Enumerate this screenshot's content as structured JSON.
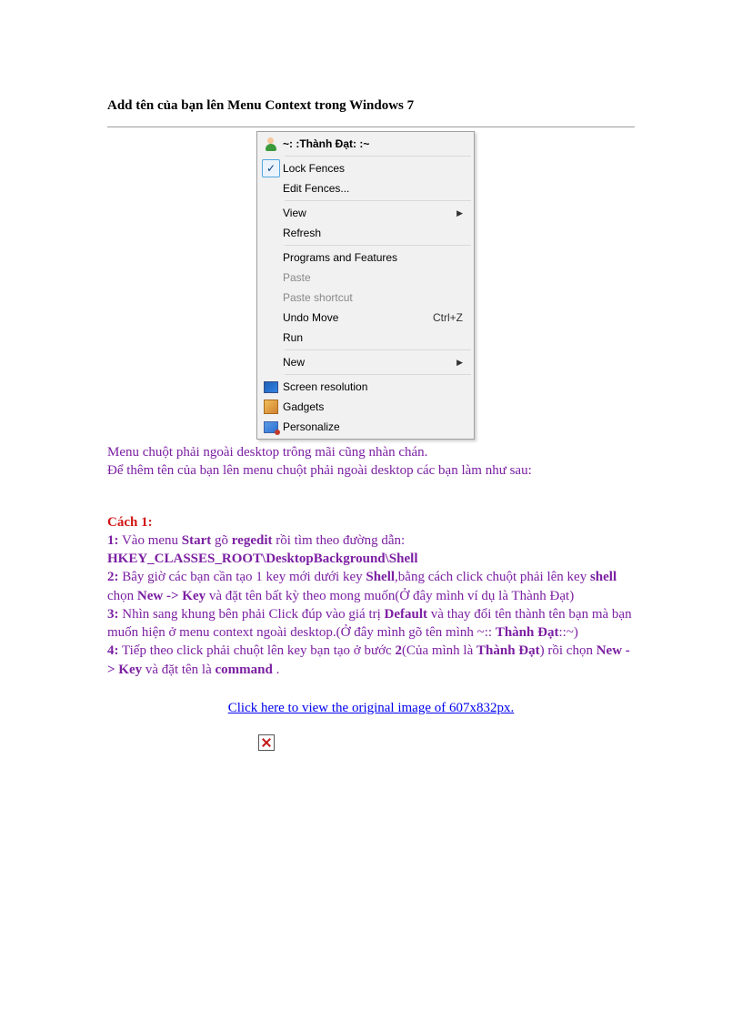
{
  "title": "Add tên của bạn lên Menu Context trong Windows  7",
  "menu": {
    "user_label": "~: :Thành Đạt: :~",
    "lock_fences": "Lock Fences",
    "edit_fences": "Edit Fences...",
    "view": "View",
    "refresh": "Refresh",
    "programs": "Programs and Features",
    "paste": "Paste",
    "paste_shortcut": "Paste shortcut",
    "undo_move": "Undo Move",
    "undo_short": "Ctrl+Z",
    "run": "Run",
    "new": "New",
    "screen_res": "Screen resolution",
    "gadgets": "Gadgets",
    "personalize": "Personalize"
  },
  "text": {
    "p1": "Menu chuột phải ngoài  desktop trông mãi cũng nhàn chán.",
    "p2": "Để thêm tên của bạn lên menu  chuột phải ngoài desktop các bạn làm như sau:",
    "cach1": "Cách 1:",
    "s1a": "1:",
    "s1b": " Vào menu  ",
    "s1c": "Start",
    "s1d": " gõ ",
    "s1e": "regedit",
    "s1f": " rồi tìm theo đường dẫn:",
    "s1path": "HKEY_CLASSES_ROOT\\DesktopBackground\\Shell",
    "s2a": "2:",
    "s2b": " Bây giờ các bạn cần tạo 1 key mới  dưới key ",
    "s2c": "Shell",
    "s2d": ",bằng cách click  chuột phải lên key ",
    "s2e": "shell",
    "s2f": " chọn ",
    "s2g": "New -> Key",
    "s2h": " và đặt tên bất kỳ theo mong muốn(Ở đây mình  ví dụ là Thành Đạt)",
    "s3a": "3:",
    "s3b": " Nhìn sang khung bên phải Click đúp vào giá trị ",
    "s3c": "Default",
    "s3d": " và thay đổi tên thành tên bạn mà bạn muốn hiện ở menu  context ngoài desktop.(Ở đây mình  gõ tên mình  ~:: ",
    "s3e": "Thành Đạt",
    "s3f": "::~)",
    "s4a": "4:",
    "s4b": " Tiếp theo click phải chuột lên key bạn tạo ở bước ",
    "s4c": "2",
    "s4d": "(Của mình  là ",
    "s4e": "Thành Đạt",
    "s4f": ") rồi chọn ",
    "s4g": "New -> Key",
    "s4h": " và đặt tên là ",
    "s4i": "command",
    "s4j": " .",
    "link": "Click  here to view  the original  image  of 607x832px."
  }
}
